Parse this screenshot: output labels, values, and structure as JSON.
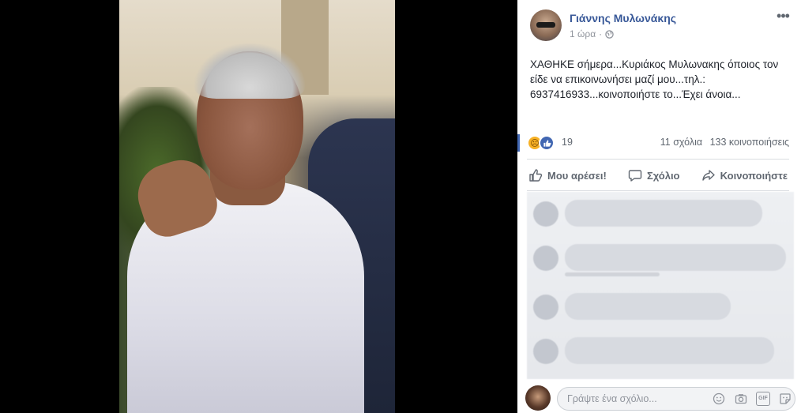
{
  "post": {
    "author": "Γιάννης Μυλωνάκης",
    "time": "1 ώρα",
    "text": "ΧΑΘΗΚΕ σήμερα...Κυριάκος Μυλωνακης όποιος τον είδε να επικοινωνήσει μαζί μου...τηλ.: 6937416933...κοινοποιήστε το...Έχει άνοια...",
    "reaction_count": "19",
    "comments": "11 σχόλια",
    "shares": "133 κοινοποιήσεις"
  },
  "actions": {
    "like": "Μου αρέσει!",
    "comment": "Σχόλιο",
    "share": "Κοινοποιήστε"
  },
  "comment_box": {
    "placeholder": "Γράψτε ένα σχόλιο..."
  },
  "icons": {
    "globe": "globe-icon",
    "more": "more-options-icon",
    "sad": "sad-reaction-icon",
    "like": "like-reaction-icon",
    "like_action": "thumbs-up-icon",
    "comment_action": "speech-bubble-icon",
    "share_action": "share-arrow-icon",
    "emoji": "emoji-icon",
    "camera": "camera-icon",
    "gif": "gif-icon",
    "sticker": "sticker-icon"
  },
  "colors": {
    "author_link": "#385898",
    "secondary_text": "#606770",
    "like_blue": "#4267b2",
    "sad_yellow": "#f7b125"
  }
}
